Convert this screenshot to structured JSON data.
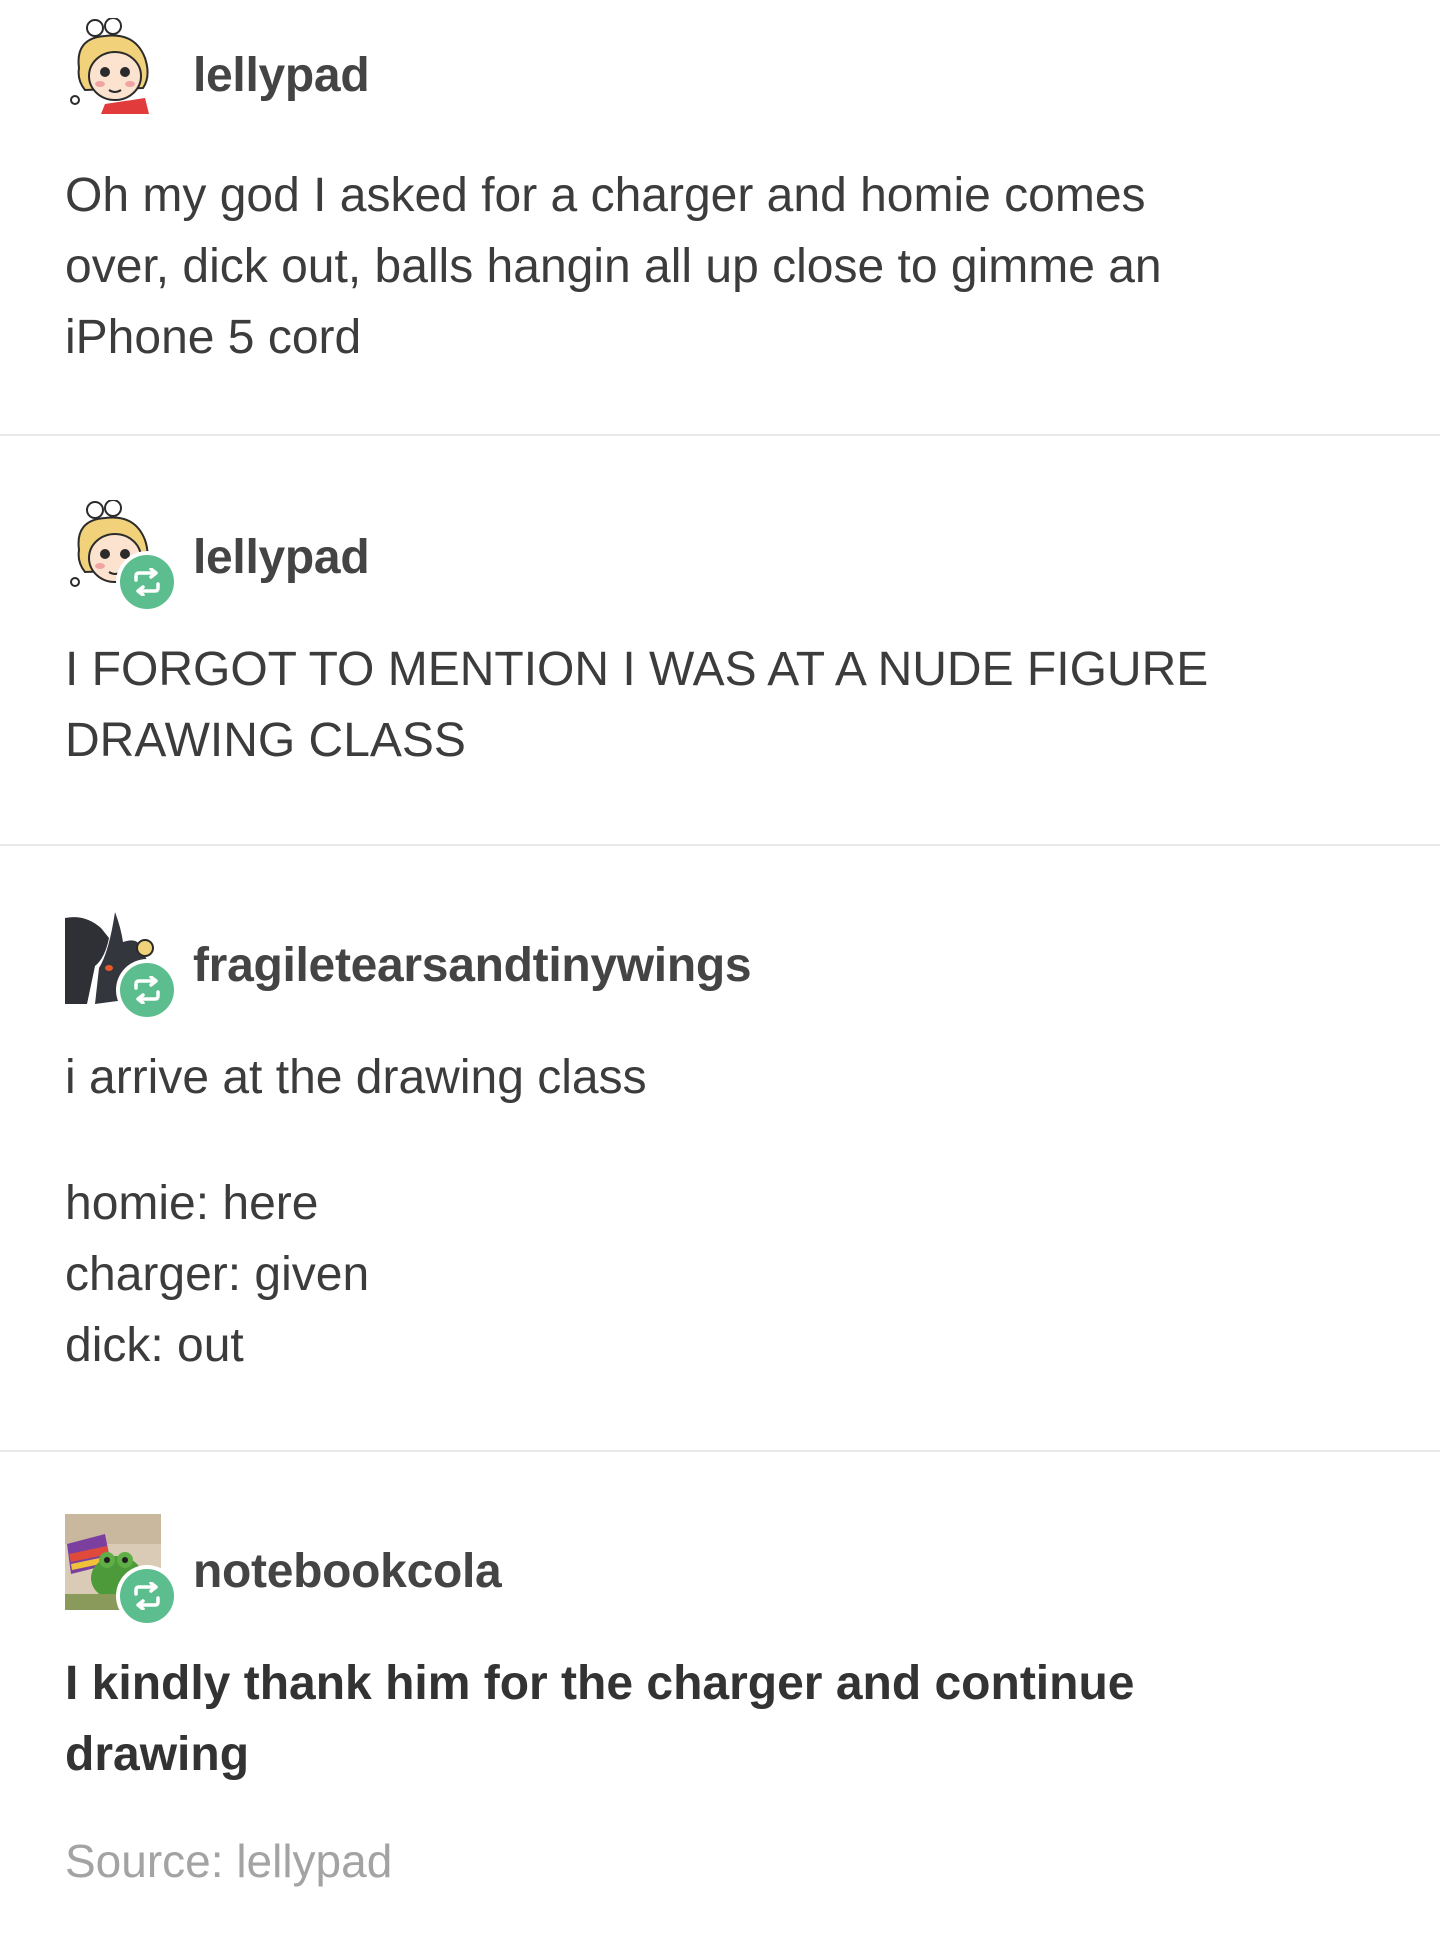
{
  "posts": [
    {
      "username": "lellypad",
      "reblog": false,
      "avatar_icon": "cartoon-face-avatar-icon",
      "lines": [
        "Oh my god I asked for a charger and homie comes",
        "over, dick out, balls hangin all up close to gimme an",
        "iPhone 5 cord"
      ]
    },
    {
      "username": "lellypad",
      "reblog": true,
      "avatar_icon": "cartoon-face-avatar-icon",
      "lines": [
        "I FORGOT TO MENTION I WAS AT A NUDE FIGURE",
        "DRAWING CLASS"
      ]
    },
    {
      "username": "fragiletearsandtinywings",
      "reblog": true,
      "avatar_icon": "dark-creature-avatar-icon",
      "lines": [
        "i arrive at the drawing class",
        "homie: here",
        "charger: given",
        "dick: out"
      ]
    },
    {
      "username": "notebookcola",
      "reblog": true,
      "avatar_icon": "frog-photo-avatar-icon",
      "bold": true,
      "lines": [
        "I kindly thank him for the charger and continue",
        "drawing"
      ]
    }
  ],
  "source": {
    "label": "Source:",
    "name": "lellypad"
  },
  "colors": {
    "reblog_green": "#5cbe8e",
    "text": "#3c3c3c",
    "source_gray": "#a3a3a3",
    "divider": "#e9e9e9"
  }
}
